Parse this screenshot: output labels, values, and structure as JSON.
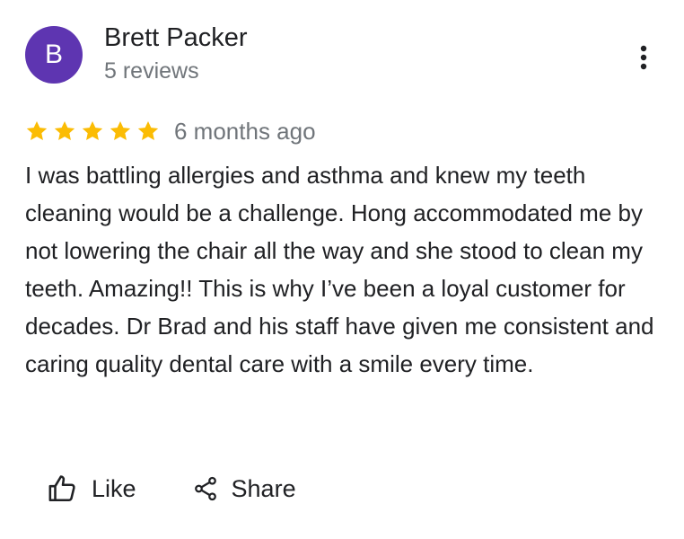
{
  "review": {
    "author": {
      "initial": "B",
      "name": "Brett Packer",
      "review_count": "5 reviews",
      "avatar_color": "#5e35b1"
    },
    "rating": 5,
    "max_rating": 5,
    "star_color": "#fbbc04",
    "date": "6 months ago",
    "text": "I was battling allergies and asthma and knew my teeth cleaning would be a challenge. Hong accommodated me by not lowering the chair all the way and she stood to clean my teeth. Amazing!! This is why I’ve been a loyal customer for decades. Dr Brad and his staff have given me consistent and caring  quality dental care with a smile every time."
  },
  "actions": {
    "like_label": "Like",
    "share_label": "Share"
  },
  "icons": {
    "more": "more-vert-icon",
    "like": "thumb-up-icon",
    "share": "share-icon",
    "star": "star-icon"
  }
}
